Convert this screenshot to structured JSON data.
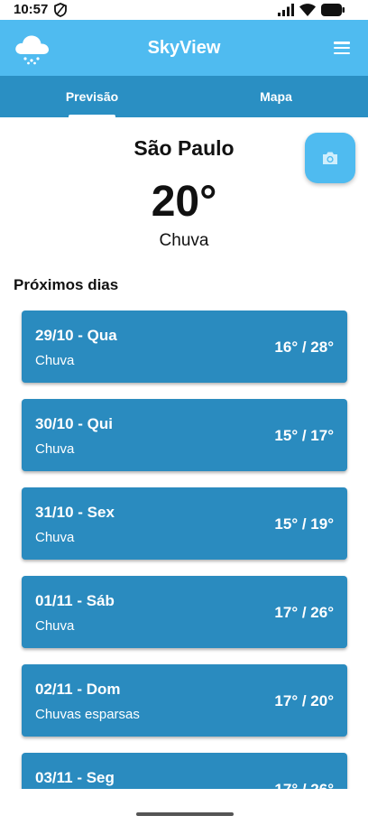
{
  "status_bar": {
    "time": "10:57"
  },
  "app_bar": {
    "title": "SkyView",
    "logo_icon": "cloud-snow-icon",
    "menu_icon": "hamburger-menu-icon"
  },
  "tabs": [
    {
      "label": "Previsão",
      "active": true
    },
    {
      "label": "Mapa",
      "active": false
    }
  ],
  "current": {
    "city": "São Paulo",
    "temperature": "20°",
    "condition": "Chuva"
  },
  "fab": {
    "icon": "camera-icon"
  },
  "forecast": {
    "title": "Próximos dias",
    "days": [
      {
        "date": "29/10 - Qua",
        "desc": "Chuva",
        "temps": "16° / 28°"
      },
      {
        "date": "30/10 - Qui",
        "desc": "Chuva",
        "temps": "15° / 17°"
      },
      {
        "date": "31/10 - Sex",
        "desc": "Chuva",
        "temps": "15° / 19°"
      },
      {
        "date": "01/11 - Sáb",
        "desc": "Chuva",
        "temps": "17° / 26°"
      },
      {
        "date": "02/11 - Dom",
        "desc": "Chuvas esparsas",
        "temps": "17° / 20°"
      },
      {
        "date": "03/11 - Seg",
        "desc": "",
        "temps": "17° / 26°"
      }
    ]
  },
  "colors": {
    "primary": "#4fbbf0",
    "primary_dark": "#2a8fc3",
    "card": "#2a8bbf"
  }
}
